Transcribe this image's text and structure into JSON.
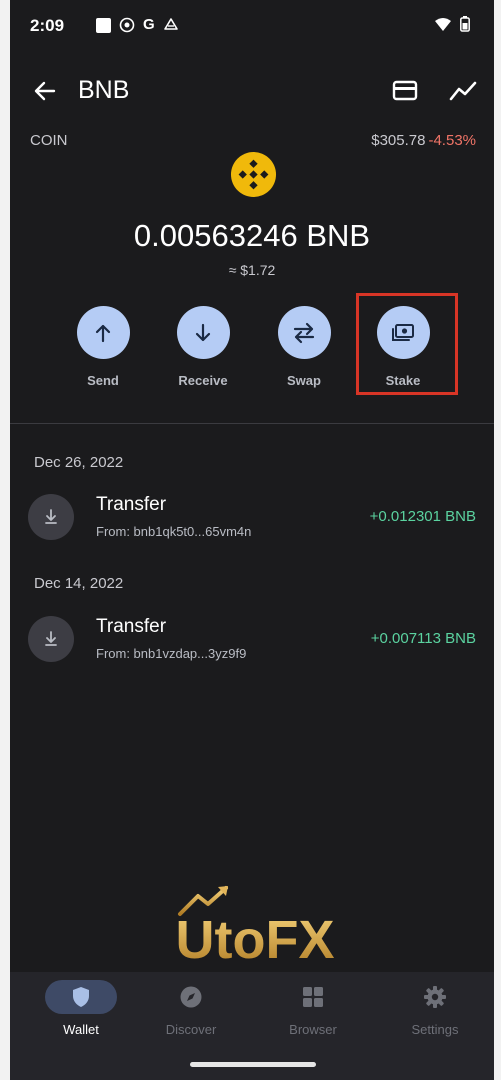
{
  "status_bar": {
    "time": "2:09",
    "g_letter": "G"
  },
  "header": {
    "title": "BNB"
  },
  "coin": {
    "label": "COIN",
    "price": "$305.78",
    "change": "-4.53%"
  },
  "balance": {
    "amount": "0.00563246 BNB",
    "fiat": "≈ $1.72"
  },
  "actions": [
    {
      "label": "Send",
      "icon": "arrow-up-icon"
    },
    {
      "label": "Receive",
      "icon": "arrow-down-icon"
    },
    {
      "label": "Swap",
      "icon": "swap-icon"
    },
    {
      "label": "Stake",
      "icon": "stake-icon"
    }
  ],
  "transactions": [
    {
      "date": "Dec 26, 2022",
      "title": "Transfer",
      "from": "From: bnb1qk5t0...65vm4n",
      "amount": "+0.012301 BNB"
    },
    {
      "date": "Dec 14, 2022",
      "title": "Transfer",
      "from": "From: bnb1vzdap...3yz9f9",
      "amount": "+0.007113 BNB"
    }
  ],
  "watermark": {
    "text": "UtoFX"
  },
  "nav": [
    {
      "label": "Wallet",
      "icon": "shield-icon",
      "active": true
    },
    {
      "label": "Discover",
      "icon": "compass-icon",
      "active": false
    },
    {
      "label": "Browser",
      "icon": "grid-icon",
      "active": false
    },
    {
      "label": "Settings",
      "icon": "gear-icon",
      "active": false
    }
  ],
  "colors": {
    "background": "#1b1b1d",
    "accent": "#b5ccf5",
    "positive": "#5bd3a0",
    "negative": "#f07467",
    "bnb": "#f0b90b",
    "highlight": "#d83526",
    "gold": "#d4a44a"
  }
}
